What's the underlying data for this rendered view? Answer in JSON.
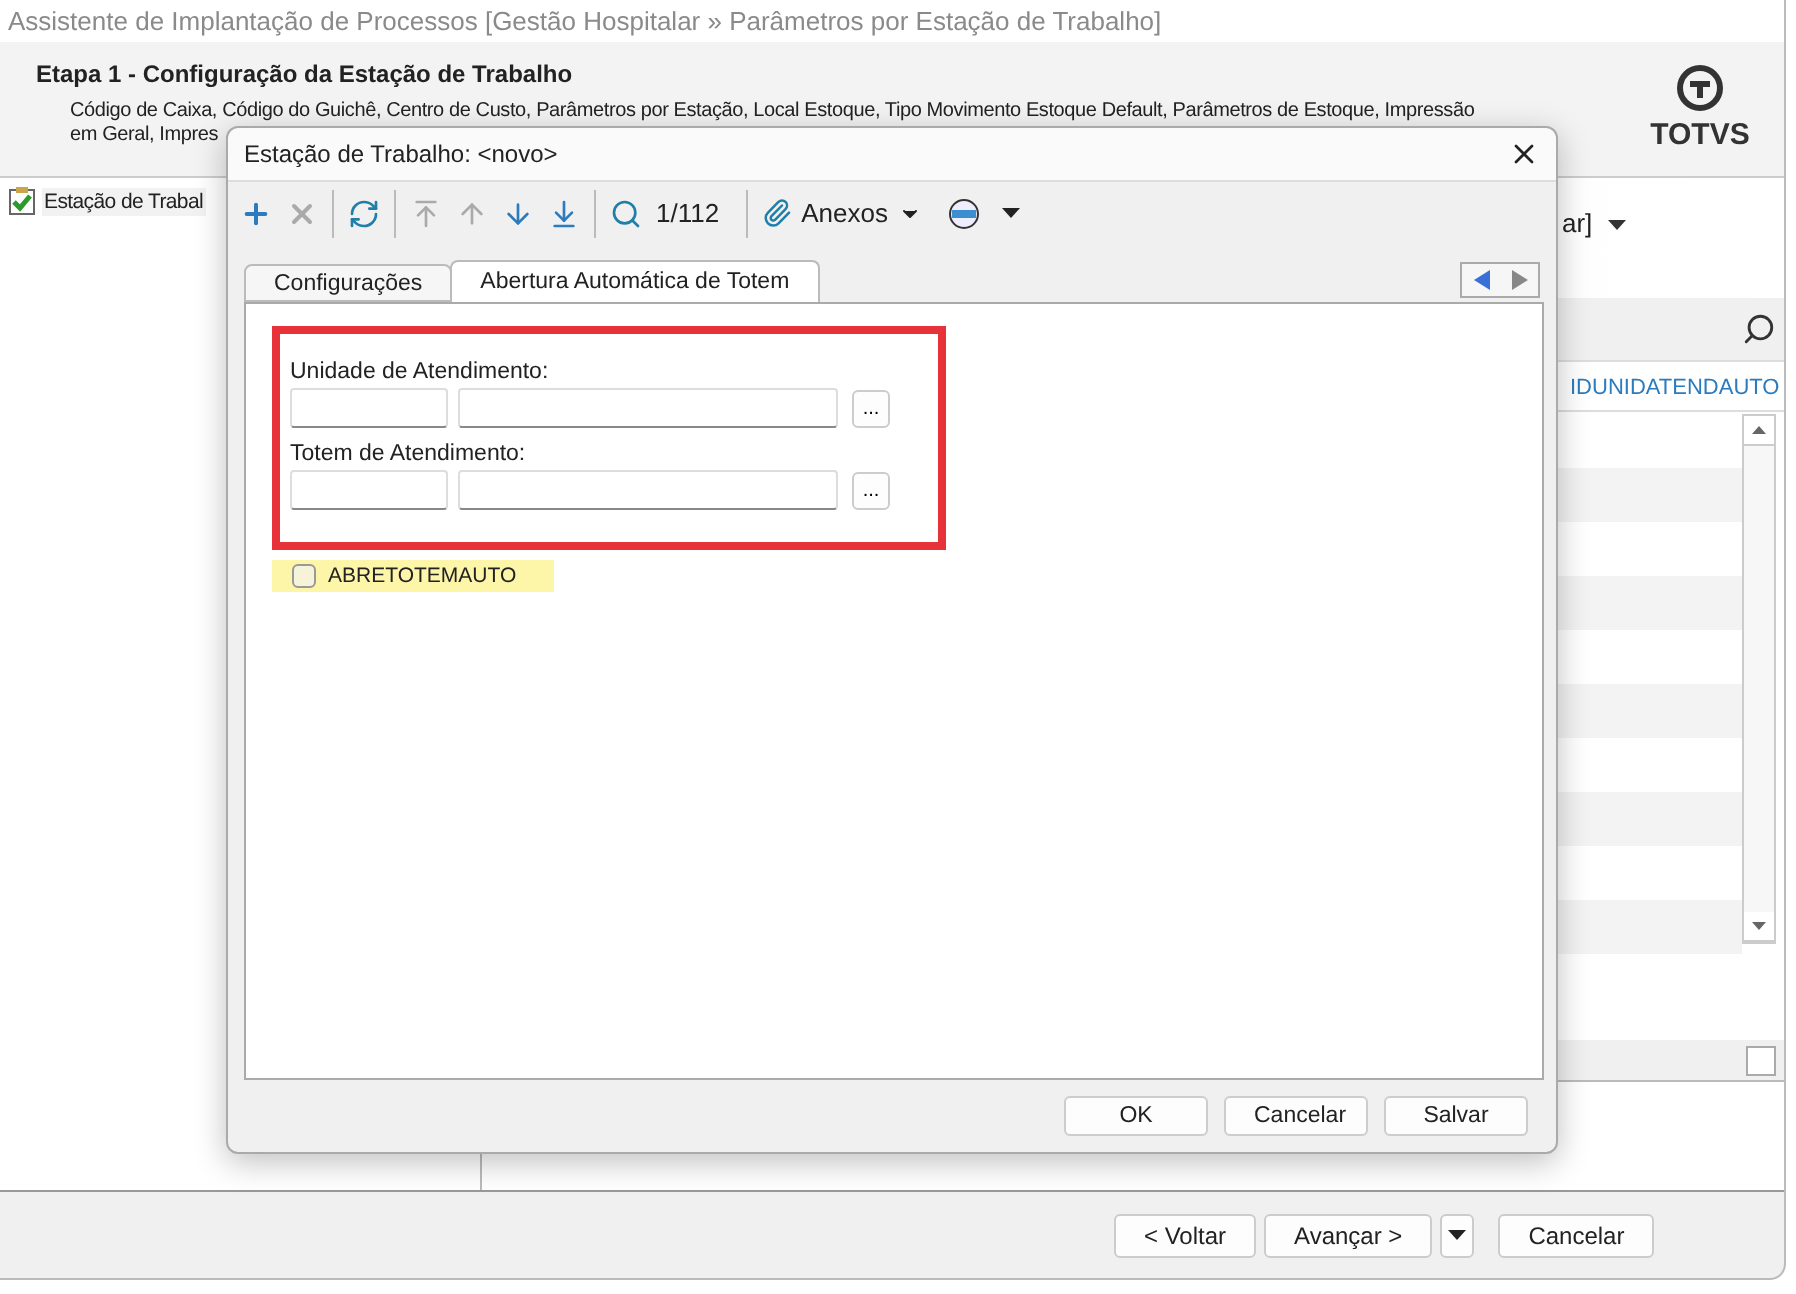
{
  "window": {
    "title": "Assistente de Implantação de Processos [Gestão Hospitalar » Parâmetros por Estação de Trabalho]"
  },
  "header": {
    "step_title": "Etapa 1 - Configuração da Estação de Trabalho",
    "description_lines": [
      "Código de Caixa, Código do Guichê, Centro de Custo, Parâmetros por Estação, Local Estoque, Tipo Movimento Estoque Default, Parâmetros de Estoque, Impressão",
      "em Geral, Impres"
    ],
    "logo_text": "TOTVS"
  },
  "tree": {
    "items": [
      {
        "label": "Estação de Trabal"
      }
    ]
  },
  "right_panel": {
    "dropdown_text": "ar]",
    "grid": {
      "columns": [
        "IDUNIDATENDAUTO"
      ]
    }
  },
  "dialog": {
    "title": "Estação de Trabalho: <novo>",
    "toolbar": [
      {
        "kind": "add",
        "disabled": false
      },
      {
        "kind": "delete",
        "disabled": true
      },
      {
        "kind": "refresh",
        "disabled": false
      },
      {
        "kind": "first",
        "disabled": true
      },
      {
        "kind": "previous",
        "disabled": true
      },
      {
        "kind": "next",
        "disabled": false
      },
      {
        "kind": "last",
        "disabled": false
      },
      {
        "kind": "search",
        "disabled": false
      }
    ],
    "record_counter": "1/112",
    "attachments_label": "Anexos",
    "tabs": [
      {
        "label": "Configurações",
        "selected": false
      },
      {
        "label": "Abertura Automática de Totem",
        "selected": true
      }
    ],
    "fields": [
      {
        "label": "Unidade de Atendimento:",
        "lookup_button": "..."
      },
      {
        "label": "Totem de Atendimento:",
        "lookup_button": "..."
      }
    ],
    "checkbox": {
      "label": "ABRETOTEMAUTO",
      "checked": false
    },
    "buttons": [
      "OK",
      "Cancelar",
      "Salvar"
    ]
  },
  "footer_buttons": [
    {
      "label": "< Voltar",
      "kind": "plain"
    },
    {
      "label": "Avançar >",
      "kind": "split"
    },
    {
      "label": "Cancelar",
      "kind": "plain"
    }
  ]
}
